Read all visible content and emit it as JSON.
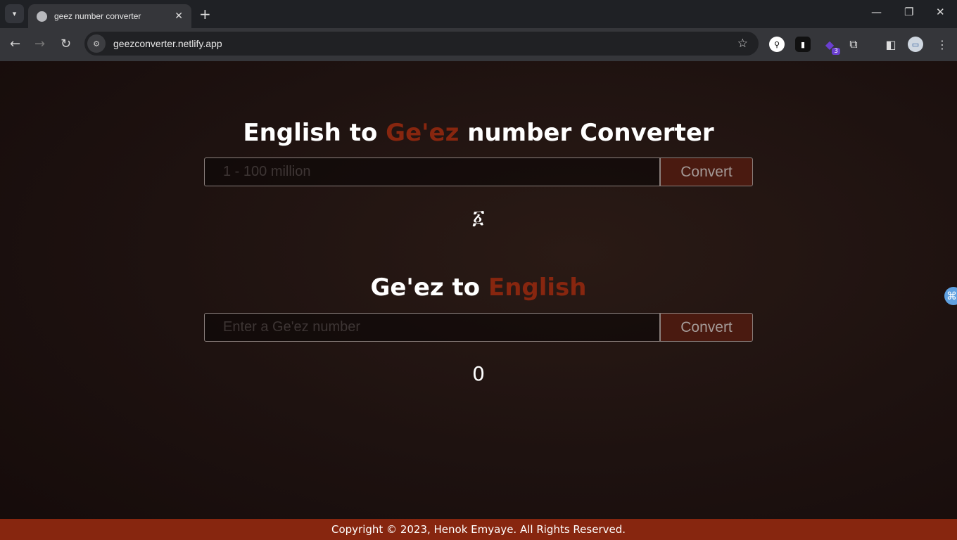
{
  "browser": {
    "tab_title": "geez number converter",
    "url": "geezconverter.netlify.app",
    "extension_badge": "3"
  },
  "page": {
    "section1": {
      "title_a": "English to ",
      "title_accent": "Ge'ez",
      "title_b": " number Converter",
      "placeholder": "1 - 100 million",
      "value": "",
      "button": "Convert",
      "result": "፩"
    },
    "section2": {
      "title_a": "Ge'ez to ",
      "title_accent": "English",
      "placeholder": "Enter a Ge'ez number",
      "value": "",
      "button": "Convert",
      "result": "0"
    },
    "footer": "Copyright © 2023, Henok Emyaye. All Rights Reserved.",
    "accent_color": "#87260f"
  }
}
